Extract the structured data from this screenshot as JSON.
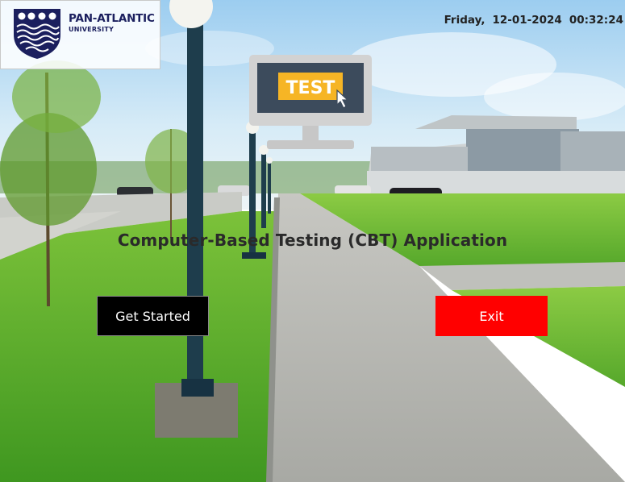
{
  "logo": {
    "title": "PAN-ATLANTIC",
    "subtitle": "UNIVERSITY",
    "crest_icon": "university-crest-icon"
  },
  "clock": {
    "day": "Friday,",
    "date": "12-01-2024",
    "time": "00:32:24"
  },
  "hero": {
    "icon_label": "TEST",
    "icon": "computer-test-icon",
    "title": "Computer-Based Testing (CBT) Application"
  },
  "buttons": {
    "start_label": "Get Started",
    "exit_label": "Exit"
  },
  "colors": {
    "brand_navy": "#1b1f5e",
    "start_button": "#000000",
    "exit_button": "#ff0000",
    "test_badge": "#f6b525"
  }
}
